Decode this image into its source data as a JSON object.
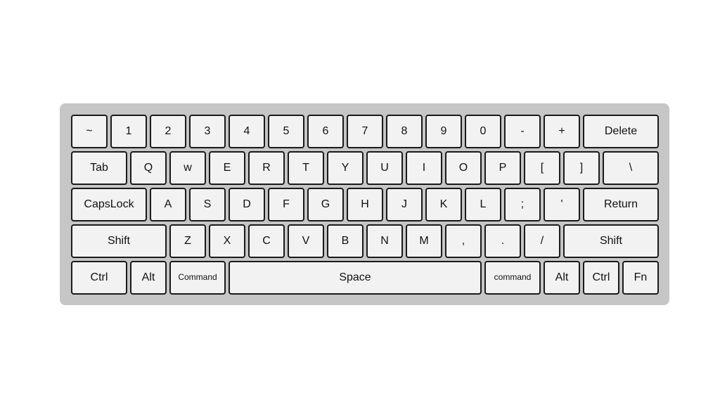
{
  "keyboard": {
    "colors": {
      "case": "#c6c6c6",
      "key": "#f2f2f2",
      "border": "#1a1a1a"
    },
    "rows": [
      {
        "keys": [
          {
            "label": "~",
            "size": "w1"
          },
          {
            "label": "1",
            "size": "w1"
          },
          {
            "label": "2",
            "size": "w1"
          },
          {
            "label": "3",
            "size": "w1"
          },
          {
            "label": "4",
            "size": "w1"
          },
          {
            "label": "5",
            "size": "w1"
          },
          {
            "label": "6",
            "size": "w1"
          },
          {
            "label": "7",
            "size": "w1"
          },
          {
            "label": "8",
            "size": "w1"
          },
          {
            "label": "9",
            "size": "w1"
          },
          {
            "label": "0",
            "size": "w1"
          },
          {
            "label": "-",
            "size": "w1"
          },
          {
            "label": "+",
            "size": "w1"
          },
          {
            "label": "Delete",
            "size": "w2"
          }
        ]
      },
      {
        "keys": [
          {
            "label": "Tab",
            "size": "w1-5"
          },
          {
            "label": "Q",
            "size": "w1"
          },
          {
            "label": "w",
            "size": "w1"
          },
          {
            "label": "E",
            "size": "w1"
          },
          {
            "label": "R",
            "size": "w1"
          },
          {
            "label": "T",
            "size": "w1"
          },
          {
            "label": "Y",
            "size": "w1"
          },
          {
            "label": "U",
            "size": "w1"
          },
          {
            "label": "I",
            "size": "w1"
          },
          {
            "label": "O",
            "size": "w1"
          },
          {
            "label": "P",
            "size": "w1"
          },
          {
            "label": "[",
            "size": "w1"
          },
          {
            "label": "]",
            "size": "w1"
          },
          {
            "label": "\\",
            "size": "w1-5"
          }
        ]
      },
      {
        "keys": [
          {
            "label": "CapsLock",
            "size": "w2"
          },
          {
            "label": "A",
            "size": "w1"
          },
          {
            "label": "S",
            "size": "w1"
          },
          {
            "label": "D",
            "size": "w1"
          },
          {
            "label": "F",
            "size": "w1"
          },
          {
            "label": "G",
            "size": "w1"
          },
          {
            "label": "H",
            "size": "w1"
          },
          {
            "label": "J",
            "size": "w1"
          },
          {
            "label": "K",
            "size": "w1"
          },
          {
            "label": "L",
            "size": "w1"
          },
          {
            "label": ";",
            "size": "w1"
          },
          {
            "label": "'",
            "size": "w1"
          },
          {
            "label": "Return",
            "size": "w2"
          }
        ]
      },
      {
        "keys": [
          {
            "label": "Shift",
            "size": "w2-5"
          },
          {
            "label": "Z",
            "size": "w1"
          },
          {
            "label": "X",
            "size": "w1"
          },
          {
            "label": "C",
            "size": "w1"
          },
          {
            "label": "V",
            "size": "w1"
          },
          {
            "label": "B",
            "size": "w1"
          },
          {
            "label": "N",
            "size": "w1"
          },
          {
            "label": "M",
            "size": "w1"
          },
          {
            "label": ",",
            "size": "w1"
          },
          {
            "label": ".",
            "size": "w1"
          },
          {
            "label": "/",
            "size": "w1"
          },
          {
            "label": "Shift",
            "size": "w2-5"
          }
        ]
      },
      {
        "keys": [
          {
            "label": "Ctrl",
            "size": "w1-5"
          },
          {
            "label": "Alt",
            "size": "w1"
          },
          {
            "label": "Command",
            "size": "w1-5",
            "small": true
          },
          {
            "label": "Space",
            "size": "w7"
          },
          {
            "label": "command",
            "size": "w1-5",
            "small": true
          },
          {
            "label": "Alt",
            "size": "w1"
          },
          {
            "label": "Ctrl",
            "size": "w1"
          },
          {
            "label": "Fn",
            "size": "w1"
          }
        ]
      }
    ]
  }
}
